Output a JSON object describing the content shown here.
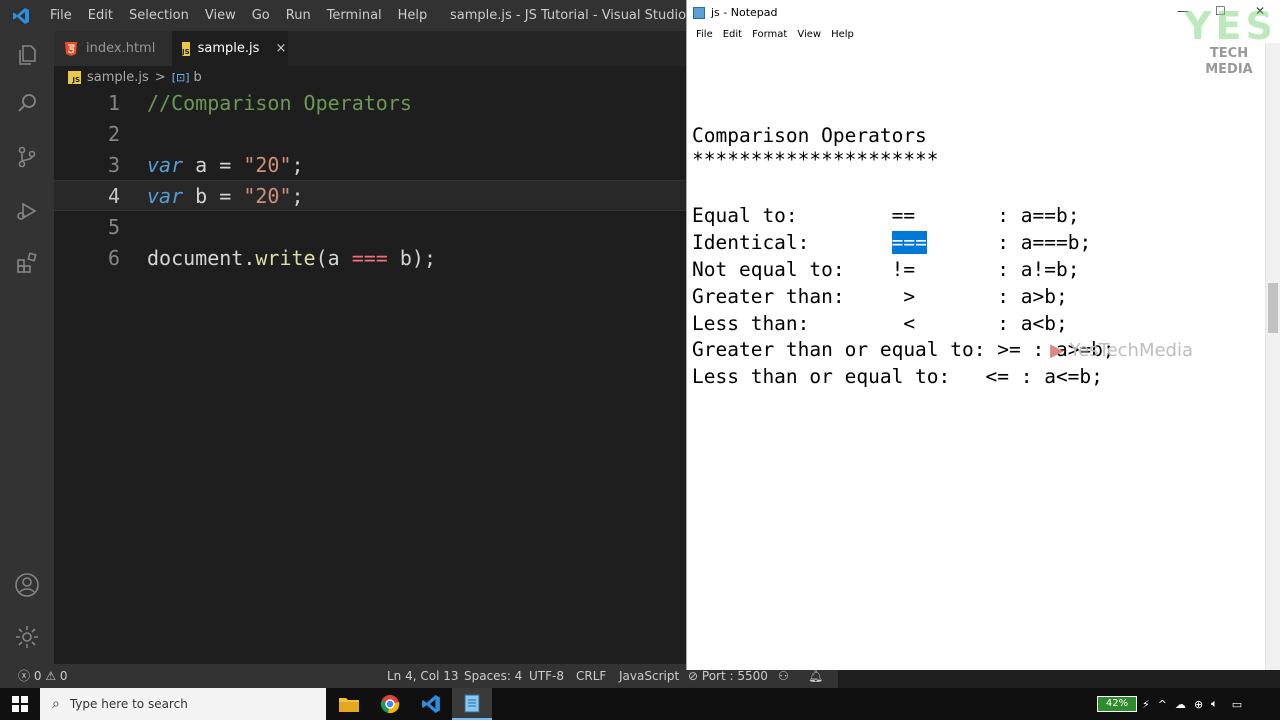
{
  "vscode": {
    "menu": [
      "File",
      "Edit",
      "Selection",
      "View",
      "Go",
      "Run",
      "Terminal",
      "Help"
    ],
    "window_title": "sample.js - JS Tutorial - Visual Studio Code",
    "tabs": [
      {
        "label": "index.html",
        "icon": "html-file-icon",
        "active": false
      },
      {
        "label": "sample.js",
        "icon": "js-file-icon",
        "active": true
      }
    ],
    "tab_close": "×",
    "breadcrumb": {
      "file": "sample.js",
      "sep": ">",
      "symbol": "b"
    },
    "lines": [
      {
        "num": "1",
        "comment": "//Comparison Operators"
      },
      {
        "num": "2"
      },
      {
        "num": "3",
        "kw": "var",
        "name": " a ",
        "eq": "=",
        "sp": " ",
        "str": "\"20\"",
        "end": ";"
      },
      {
        "num": "4",
        "kw": "var",
        "name": " b ",
        "eq": "=",
        "sp": " ",
        "str": "\"20\"",
        "end": ";"
      },
      {
        "num": "5"
      },
      {
        "num": "6",
        "obj": "document.",
        "fn": "write",
        "args1": "(a ",
        "op": "===",
        "args2": " b);"
      }
    ],
    "status": {
      "errors": "0",
      "warnings": "0",
      "position": "Ln 4, Col 13",
      "spaces": "Spaces: 4",
      "encoding": "UTF-8",
      "eol": "CRLF",
      "language": "JavaScript",
      "port": "Port : 5500"
    }
  },
  "notepad": {
    "title": "js - Notepad",
    "menu": [
      "File",
      "Edit",
      "Format",
      "View",
      "Help"
    ],
    "heading": "Comparison Operators",
    "stars": "*********************",
    "rows": [
      {
        "pre": "Equal to:        ",
        "sel": "",
        "post": "==       : a==b;"
      },
      {
        "pre": "Identical:       ",
        "sel": "===",
        "post": "      : a===b;"
      },
      {
        "pre": "Not equal to:    ",
        "sel": "",
        "post": "!=       : a!=b;"
      },
      {
        "pre": "Greater than:    ",
        "sel": "",
        "post": " >       : a>b;"
      },
      {
        "pre": "Less than:       ",
        "sel": "",
        "post": " <       : a<b;"
      },
      {
        "pre": "Greater than or equal to: ",
        "sel": "",
        "post": ">= : a>=b;"
      },
      {
        "pre": "Less than or equal to:   ",
        "sel": "",
        "post": "<= : a<=b;"
      }
    ]
  },
  "brand": {
    "yes": "YES",
    "tech_media": "TECH MEDIA",
    "watermark": "YesTechMedia"
  },
  "taskbar": {
    "search_placeholder": "Type here to search",
    "battery": "42%"
  }
}
